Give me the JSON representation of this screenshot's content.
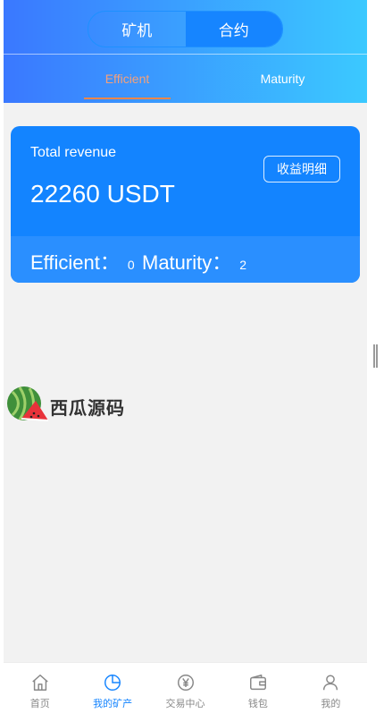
{
  "header": {
    "segments": [
      {
        "label": "矿机",
        "active": false
      },
      {
        "label": "合约",
        "active": true
      }
    ],
    "tabs": [
      {
        "label": "Efficient",
        "active": true
      },
      {
        "label": "Maturity",
        "active": false
      }
    ]
  },
  "card": {
    "revenue_label": "Total revenue",
    "revenue_value": "22260 USDT",
    "detail_button": "收益明细",
    "efficient_label": "Efficient：",
    "efficient_count": "0",
    "maturity_label": "Maturity：",
    "maturity_count": "2"
  },
  "watermark": {
    "text": "西瓜源码",
    "icon": "watermelon-icon"
  },
  "bottom_nav": {
    "items": [
      {
        "label": "首页",
        "icon": "home-icon",
        "active": false
      },
      {
        "label": "我的矿产",
        "icon": "pie-chart-icon",
        "active": true
      },
      {
        "label": "交易中心",
        "icon": "yen-coin-icon",
        "active": false
      },
      {
        "label": "钱包",
        "icon": "wallet-icon",
        "active": false
      },
      {
        "label": "我的",
        "icon": "user-icon",
        "active": false
      }
    ]
  },
  "colors": {
    "header_gradient_start": "#3a78ff",
    "header_gradient_end": "#3bc9ff",
    "card_blue": "#1384ff",
    "active_tab": "#f5a07a",
    "nav_active": "#1685ff"
  }
}
